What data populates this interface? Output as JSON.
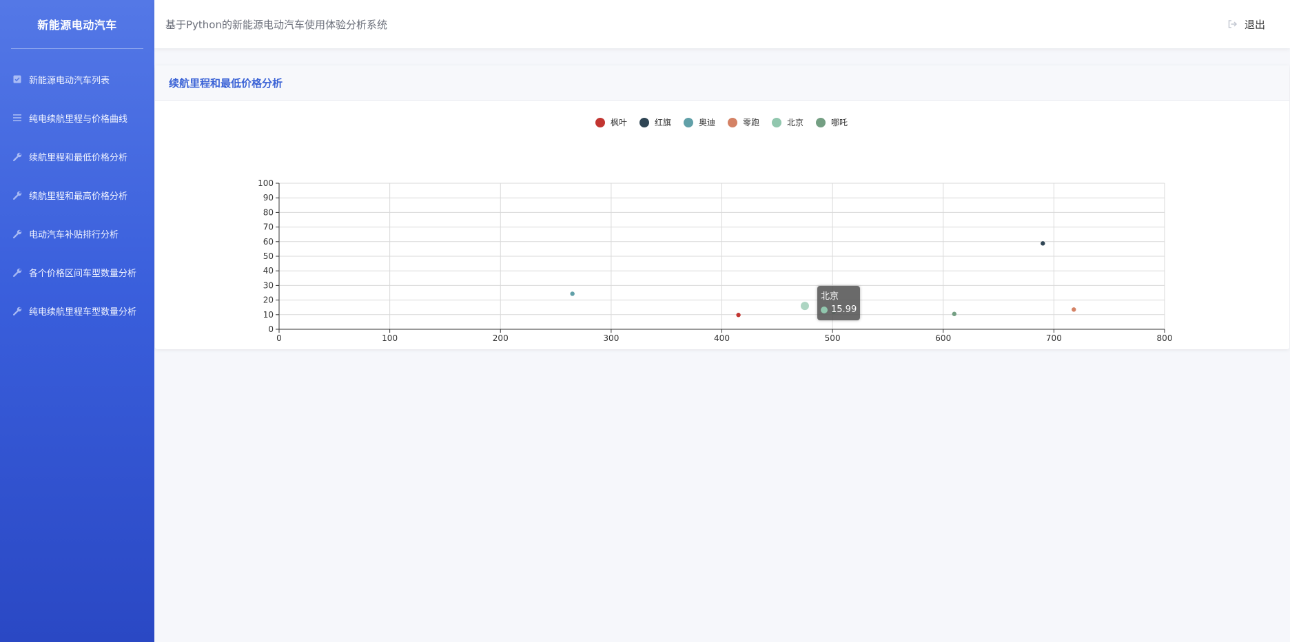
{
  "app": {
    "brand": "新能源电动汽车",
    "header_title": "基于Python的新能源电动汽车使用体验分析系统",
    "logout_label": "退出"
  },
  "sidebar": {
    "items": [
      {
        "label": "新能源电动汽车列表",
        "icon": "checkbox-icon"
      },
      {
        "label": "纯电续航里程与价格曲线",
        "icon": "list-icon"
      },
      {
        "label": "续航里程和最低价格分析",
        "icon": "wrench-icon"
      },
      {
        "label": "续航里程和最高价格分析",
        "icon": "wrench-icon"
      },
      {
        "label": "电动汽车补贴排行分析",
        "icon": "wrench-icon"
      },
      {
        "label": "各个价格区间车型数量分析",
        "icon": "wrench-icon"
      },
      {
        "label": "纯电续航里程车型数量分析",
        "icon": "wrench-icon"
      }
    ]
  },
  "card": {
    "title": "续航里程和最低价格分析"
  },
  "tooltip": {
    "series": "北京",
    "value": "15.99",
    "color": "#91c7ae"
  },
  "chart_data": {
    "type": "scatter",
    "title": "",
    "xlabel": "",
    "ylabel": "",
    "xlim": [
      0,
      800
    ],
    "ylim": [
      0,
      100
    ],
    "x_ticks": [
      "0",
      "100",
      "200",
      "300",
      "400",
      "500",
      "600",
      "700",
      "800"
    ],
    "y_ticks": [
      "0",
      "10",
      "20",
      "30",
      "40",
      "50",
      "60",
      "70",
      "80",
      "90",
      "100"
    ],
    "grid": true,
    "legend_position": "top-center",
    "series": [
      {
        "name": "枫叶",
        "color": "#c23531",
        "points": [
          [
            415,
            9.8
          ]
        ]
      },
      {
        "name": "红旗",
        "color": "#2f4554",
        "points": [
          [
            690,
            58.8
          ]
        ]
      },
      {
        "name": "奥迪",
        "color": "#61a0a8",
        "points": [
          [
            265,
            24.3
          ]
        ]
      },
      {
        "name": "零跑",
        "color": "#d48265",
        "points": [
          [
            718,
            13.5
          ]
        ]
      },
      {
        "name": "北京",
        "color": "#91c7ae",
        "points": [
          [
            475,
            15.99
          ],
          [
            501,
            11.8
          ]
        ],
        "highlighted_index": 0
      },
      {
        "name": "哪吒",
        "color": "#749f83",
        "points": [
          [
            610,
            10.5
          ]
        ]
      }
    ]
  }
}
